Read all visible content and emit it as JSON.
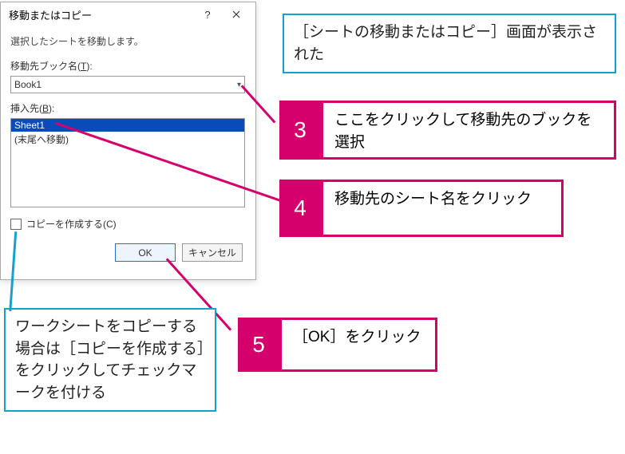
{
  "dialog": {
    "title": "移動またはコピー",
    "help_icon": "?",
    "close_icon": "×",
    "description": "選択したシートを移動します。",
    "book_label_pre": "移動先ブック名(",
    "book_label_key": "T",
    "book_label_post": "):",
    "book_value": "Book1",
    "insert_label_pre": "挿入先(",
    "insert_label_key": "B",
    "insert_label_post": "):",
    "list": {
      "items": [
        {
          "label": "Sheet1",
          "selected": true
        },
        {
          "label": "(末尾へ移動)",
          "selected": false
        }
      ]
    },
    "copy_label_pre": "コピーを作成する(",
    "copy_label_key": "C",
    "copy_label_post": ")",
    "ok": "OK",
    "cancel": "キャンセル"
  },
  "callouts": {
    "top_blue": "［シートの移動またはコピー］画面が表示された",
    "bottom_blue": "ワークシートをコピーする場合は［コピーを作成する］をクリックしてチェックマークを付ける",
    "step3": {
      "num": "3",
      "text": "ここをクリックして移動先のブックを選択"
    },
    "step4": {
      "num": "4",
      "text": "移動先のシート名をクリック"
    },
    "step5": {
      "num": "5",
      "text": "［OK］をクリック"
    }
  }
}
